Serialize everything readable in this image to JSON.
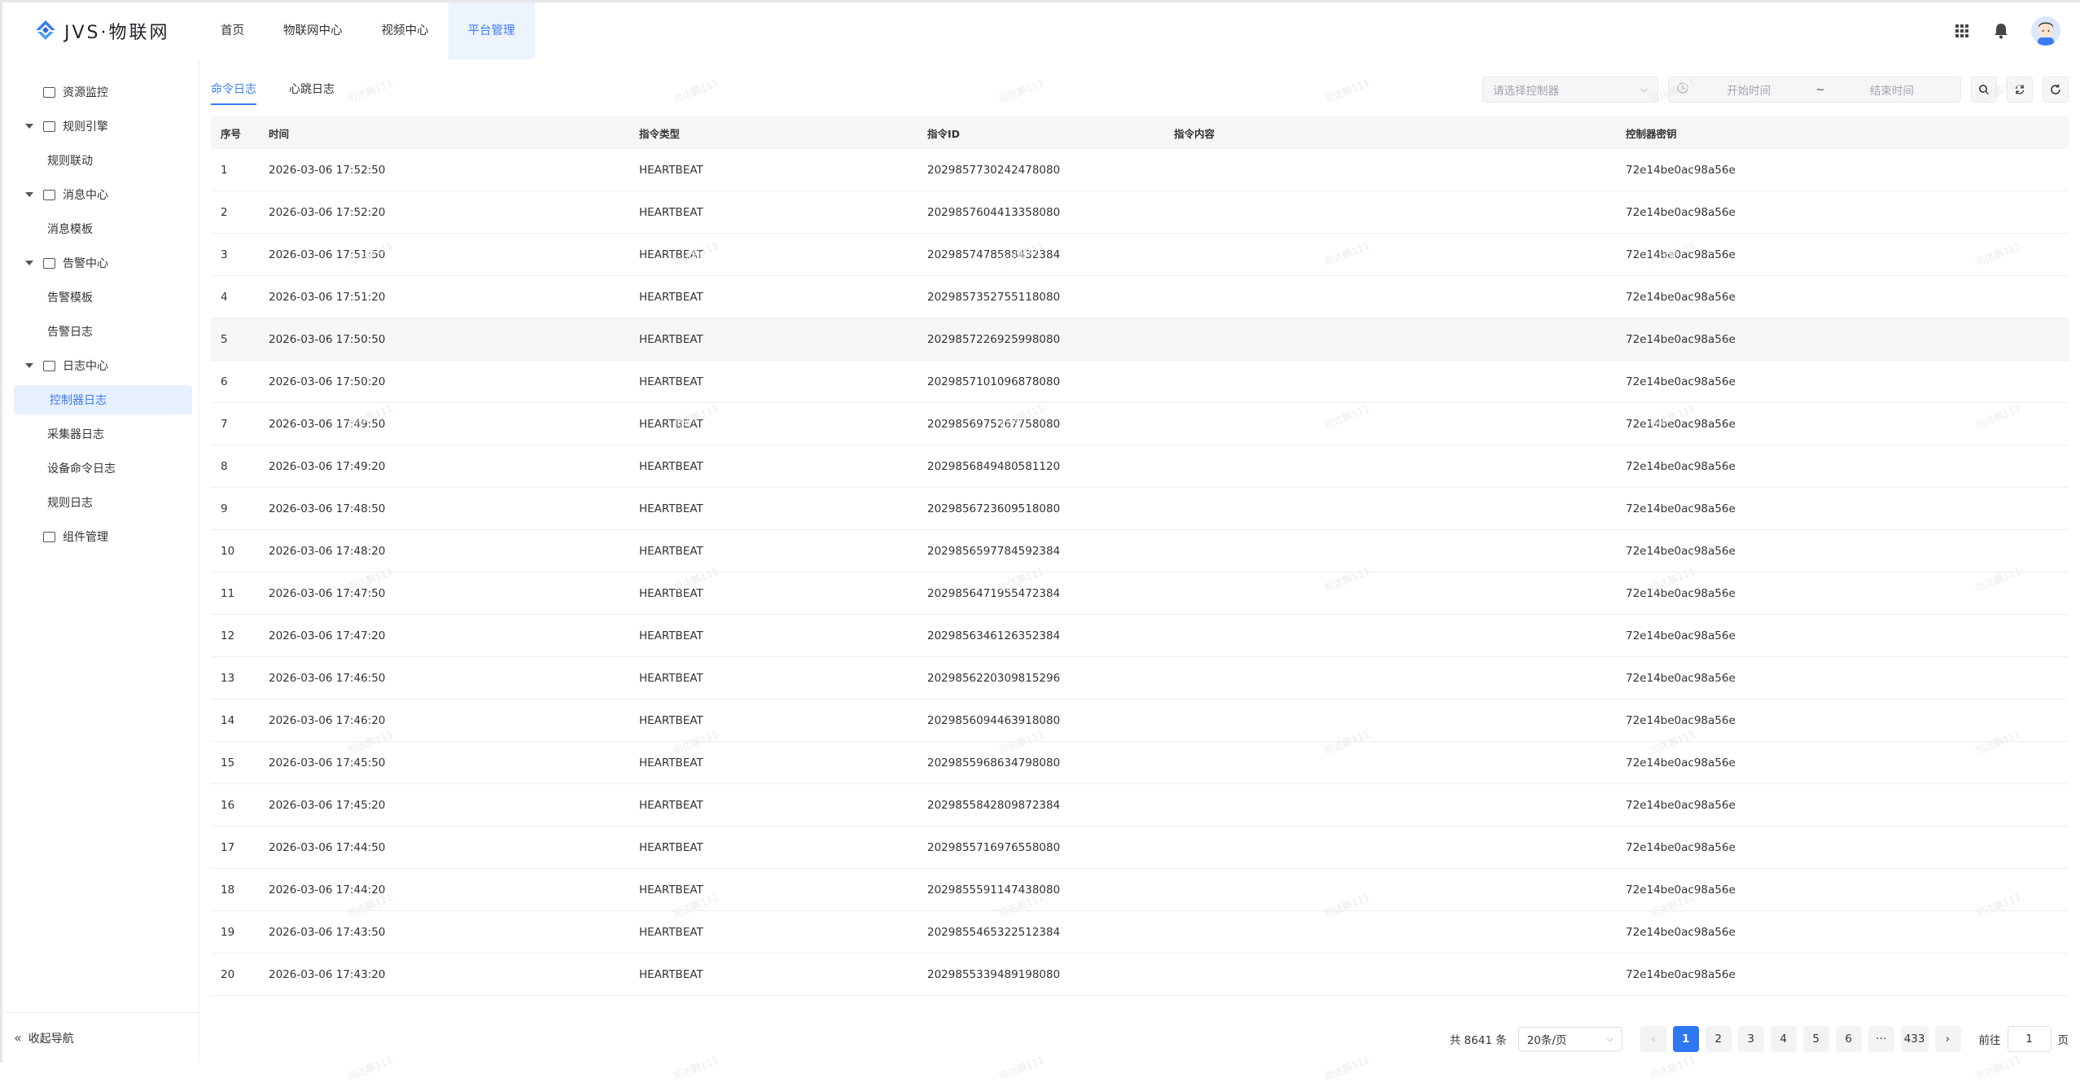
{
  "brand": {
    "name": "JVS·物联网",
    "accent": "#3c7cf5"
  },
  "top_nav": [
    {
      "label": "首页",
      "active": false
    },
    {
      "label": "物联网中心",
      "active": false
    },
    {
      "label": "视频中心",
      "active": false
    },
    {
      "label": "平台管理",
      "active": true
    }
  ],
  "header_icons": [
    "grid-apps-icon",
    "bell-icon",
    "avatar"
  ],
  "sidebar": {
    "items": [
      {
        "label": "资源监控",
        "icon": "monitor-icon",
        "level": 1,
        "expandable": false
      },
      {
        "label": "规则引擎",
        "icon": "folder-icon",
        "level": 1,
        "expandable": true
      },
      {
        "label": "规则联动",
        "level": 2
      },
      {
        "label": "消息中心",
        "icon": "folder-icon",
        "level": 1,
        "expandable": true
      },
      {
        "label": "消息模板",
        "level": 2
      },
      {
        "label": "告警中心",
        "icon": "folder-icon",
        "level": 1,
        "expandable": true
      },
      {
        "label": "告警模板",
        "level": 2
      },
      {
        "label": "告警日志",
        "level": 2
      },
      {
        "label": "日志中心",
        "icon": "document-icon",
        "level": 1,
        "expandable": true
      },
      {
        "label": "控制器日志",
        "level": 2,
        "active": true
      },
      {
        "label": "采集器日志",
        "level": 2
      },
      {
        "label": "设备命令日志",
        "level": 2
      },
      {
        "label": "规则日志",
        "level": 2
      },
      {
        "label": "组件管理",
        "icon": "monitor-icon",
        "level": 1,
        "expandable": false
      }
    ],
    "collapse_label": "收起导航"
  },
  "tabs": [
    {
      "label": "命令日志",
      "active": true
    },
    {
      "label": "心跳日志",
      "active": false
    }
  ],
  "filters": {
    "controller_placeholder": "请选择控制器",
    "start_placeholder": "开始时间",
    "range_separator": "~",
    "end_placeholder": "结束时间"
  },
  "table": {
    "columns": [
      "序号",
      "时间",
      "指令类型",
      "指令ID",
      "指令内容",
      "控制器密钥"
    ],
    "rows": [
      [
        "1",
        "2026-03-06 17:52:50",
        "HEARTBEAT",
        "2029857730242478080",
        "",
        "72e14be0ac98a56e"
      ],
      [
        "2",
        "2026-03-06 17:52:20",
        "HEARTBEAT",
        "2029857604413358080",
        "",
        "72e14be0ac98a56e"
      ],
      [
        "3",
        "2026-03-06 17:51:50",
        "HEARTBEAT",
        "2029857478588432384",
        "",
        "72e14be0ac98a56e"
      ],
      [
        "4",
        "2026-03-06 17:51:20",
        "HEARTBEAT",
        "2029857352755118080",
        "",
        "72e14be0ac98a56e"
      ],
      [
        "5",
        "2026-03-06 17:50:50",
        "HEARTBEAT",
        "2029857226925998080",
        "",
        "72e14be0ac98a56e"
      ],
      [
        "6",
        "2026-03-06 17:50:20",
        "HEARTBEAT",
        "2029857101096878080",
        "",
        "72e14be0ac98a56e"
      ],
      [
        "7",
        "2026-03-06 17:49:50",
        "HEARTBEAT",
        "2029856975267758080",
        "",
        "72e14be0ac98a56e"
      ],
      [
        "8",
        "2026-03-06 17:49:20",
        "HEARTBEAT",
        "2029856849480581120",
        "",
        "72e14be0ac98a56e"
      ],
      [
        "9",
        "2026-03-06 17:48:50",
        "HEARTBEAT",
        "2029856723609518080",
        "",
        "72e14be0ac98a56e"
      ],
      [
        "10",
        "2026-03-06 17:48:20",
        "HEARTBEAT",
        "2029856597784592384",
        "",
        "72e14be0ac98a56e"
      ],
      [
        "11",
        "2026-03-06 17:47:50",
        "HEARTBEAT",
        "2029856471955472384",
        "",
        "72e14be0ac98a56e"
      ],
      [
        "12",
        "2026-03-06 17:47:20",
        "HEARTBEAT",
        "2029856346126352384",
        "",
        "72e14be0ac98a56e"
      ],
      [
        "13",
        "2026-03-06 17:46:50",
        "HEARTBEAT",
        "2029856220309815296",
        "",
        "72e14be0ac98a56e"
      ],
      [
        "14",
        "2026-03-06 17:46:20",
        "HEARTBEAT",
        "2029856094463918080",
        "",
        "72e14be0ac98a56e"
      ],
      [
        "15",
        "2026-03-06 17:45:50",
        "HEARTBEAT",
        "2029855968634798080",
        "",
        "72e14be0ac98a56e"
      ],
      [
        "16",
        "2026-03-06 17:45:20",
        "HEARTBEAT",
        "2029855842809872384",
        "",
        "72e14be0ac98a56e"
      ],
      [
        "17",
        "2026-03-06 17:44:50",
        "HEARTBEAT",
        "2029855716976558080",
        "",
        "72e14be0ac98a56e"
      ],
      [
        "18",
        "2026-03-06 17:44:20",
        "HEARTBEAT",
        "2029855591147438080",
        "",
        "72e14be0ac98a56e"
      ],
      [
        "19",
        "2026-03-06 17:43:50",
        "HEARTBEAT",
        "2029855465322512384",
        "",
        "72e14be0ac98a56e"
      ],
      [
        "20",
        "2026-03-06 17:43:20",
        "HEARTBEAT",
        "2029855339489198080",
        "",
        "72e14be0ac98a56e"
      ]
    ],
    "hover_row": 5
  },
  "pagination": {
    "total_label": "共 8641 条",
    "page_size": "20条/页",
    "pages": [
      "1",
      "2",
      "3",
      "4",
      "5",
      "6",
      "···",
      "433"
    ],
    "current_page": "1",
    "jump_prefix": "前往",
    "jump_value": "1",
    "jump_suffix": "页"
  },
  "watermark": "司达鹏111"
}
